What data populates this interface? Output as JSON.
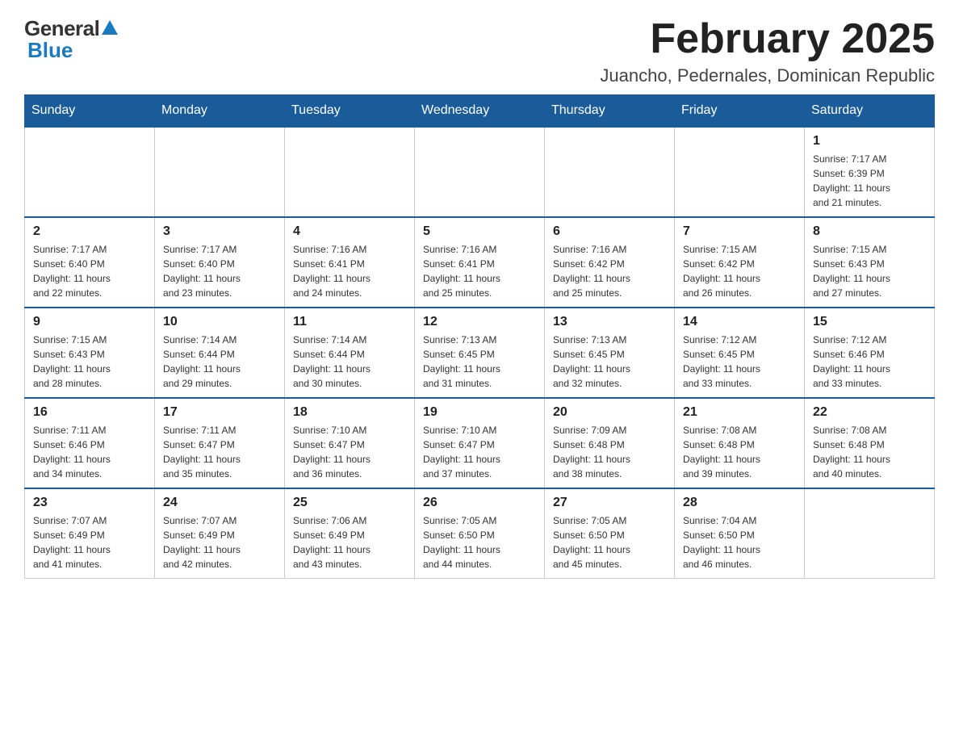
{
  "logo": {
    "general": "General",
    "blue": "Blue"
  },
  "header": {
    "title": "February 2025",
    "location": "Juancho, Pedernales, Dominican Republic"
  },
  "weekdays": [
    "Sunday",
    "Monday",
    "Tuesday",
    "Wednesday",
    "Thursday",
    "Friday",
    "Saturday"
  ],
  "weeks": [
    [
      {
        "day": "",
        "info": ""
      },
      {
        "day": "",
        "info": ""
      },
      {
        "day": "",
        "info": ""
      },
      {
        "day": "",
        "info": ""
      },
      {
        "day": "",
        "info": ""
      },
      {
        "day": "",
        "info": ""
      },
      {
        "day": "1",
        "info": "Sunrise: 7:17 AM\nSunset: 6:39 PM\nDaylight: 11 hours\nand 21 minutes."
      }
    ],
    [
      {
        "day": "2",
        "info": "Sunrise: 7:17 AM\nSunset: 6:40 PM\nDaylight: 11 hours\nand 22 minutes."
      },
      {
        "day": "3",
        "info": "Sunrise: 7:17 AM\nSunset: 6:40 PM\nDaylight: 11 hours\nand 23 minutes."
      },
      {
        "day": "4",
        "info": "Sunrise: 7:16 AM\nSunset: 6:41 PM\nDaylight: 11 hours\nand 24 minutes."
      },
      {
        "day": "5",
        "info": "Sunrise: 7:16 AM\nSunset: 6:41 PM\nDaylight: 11 hours\nand 25 minutes."
      },
      {
        "day": "6",
        "info": "Sunrise: 7:16 AM\nSunset: 6:42 PM\nDaylight: 11 hours\nand 25 minutes."
      },
      {
        "day": "7",
        "info": "Sunrise: 7:15 AM\nSunset: 6:42 PM\nDaylight: 11 hours\nand 26 minutes."
      },
      {
        "day": "8",
        "info": "Sunrise: 7:15 AM\nSunset: 6:43 PM\nDaylight: 11 hours\nand 27 minutes."
      }
    ],
    [
      {
        "day": "9",
        "info": "Sunrise: 7:15 AM\nSunset: 6:43 PM\nDaylight: 11 hours\nand 28 minutes."
      },
      {
        "day": "10",
        "info": "Sunrise: 7:14 AM\nSunset: 6:44 PM\nDaylight: 11 hours\nand 29 minutes."
      },
      {
        "day": "11",
        "info": "Sunrise: 7:14 AM\nSunset: 6:44 PM\nDaylight: 11 hours\nand 30 minutes."
      },
      {
        "day": "12",
        "info": "Sunrise: 7:13 AM\nSunset: 6:45 PM\nDaylight: 11 hours\nand 31 minutes."
      },
      {
        "day": "13",
        "info": "Sunrise: 7:13 AM\nSunset: 6:45 PM\nDaylight: 11 hours\nand 32 minutes."
      },
      {
        "day": "14",
        "info": "Sunrise: 7:12 AM\nSunset: 6:45 PM\nDaylight: 11 hours\nand 33 minutes."
      },
      {
        "day": "15",
        "info": "Sunrise: 7:12 AM\nSunset: 6:46 PM\nDaylight: 11 hours\nand 33 minutes."
      }
    ],
    [
      {
        "day": "16",
        "info": "Sunrise: 7:11 AM\nSunset: 6:46 PM\nDaylight: 11 hours\nand 34 minutes."
      },
      {
        "day": "17",
        "info": "Sunrise: 7:11 AM\nSunset: 6:47 PM\nDaylight: 11 hours\nand 35 minutes."
      },
      {
        "day": "18",
        "info": "Sunrise: 7:10 AM\nSunset: 6:47 PM\nDaylight: 11 hours\nand 36 minutes."
      },
      {
        "day": "19",
        "info": "Sunrise: 7:10 AM\nSunset: 6:47 PM\nDaylight: 11 hours\nand 37 minutes."
      },
      {
        "day": "20",
        "info": "Sunrise: 7:09 AM\nSunset: 6:48 PM\nDaylight: 11 hours\nand 38 minutes."
      },
      {
        "day": "21",
        "info": "Sunrise: 7:08 AM\nSunset: 6:48 PM\nDaylight: 11 hours\nand 39 minutes."
      },
      {
        "day": "22",
        "info": "Sunrise: 7:08 AM\nSunset: 6:48 PM\nDaylight: 11 hours\nand 40 minutes."
      }
    ],
    [
      {
        "day": "23",
        "info": "Sunrise: 7:07 AM\nSunset: 6:49 PM\nDaylight: 11 hours\nand 41 minutes."
      },
      {
        "day": "24",
        "info": "Sunrise: 7:07 AM\nSunset: 6:49 PM\nDaylight: 11 hours\nand 42 minutes."
      },
      {
        "day": "25",
        "info": "Sunrise: 7:06 AM\nSunset: 6:49 PM\nDaylight: 11 hours\nand 43 minutes."
      },
      {
        "day": "26",
        "info": "Sunrise: 7:05 AM\nSunset: 6:50 PM\nDaylight: 11 hours\nand 44 minutes."
      },
      {
        "day": "27",
        "info": "Sunrise: 7:05 AM\nSunset: 6:50 PM\nDaylight: 11 hours\nand 45 minutes."
      },
      {
        "day": "28",
        "info": "Sunrise: 7:04 AM\nSunset: 6:50 PM\nDaylight: 11 hours\nand 46 minutes."
      },
      {
        "day": "",
        "info": ""
      }
    ]
  ]
}
